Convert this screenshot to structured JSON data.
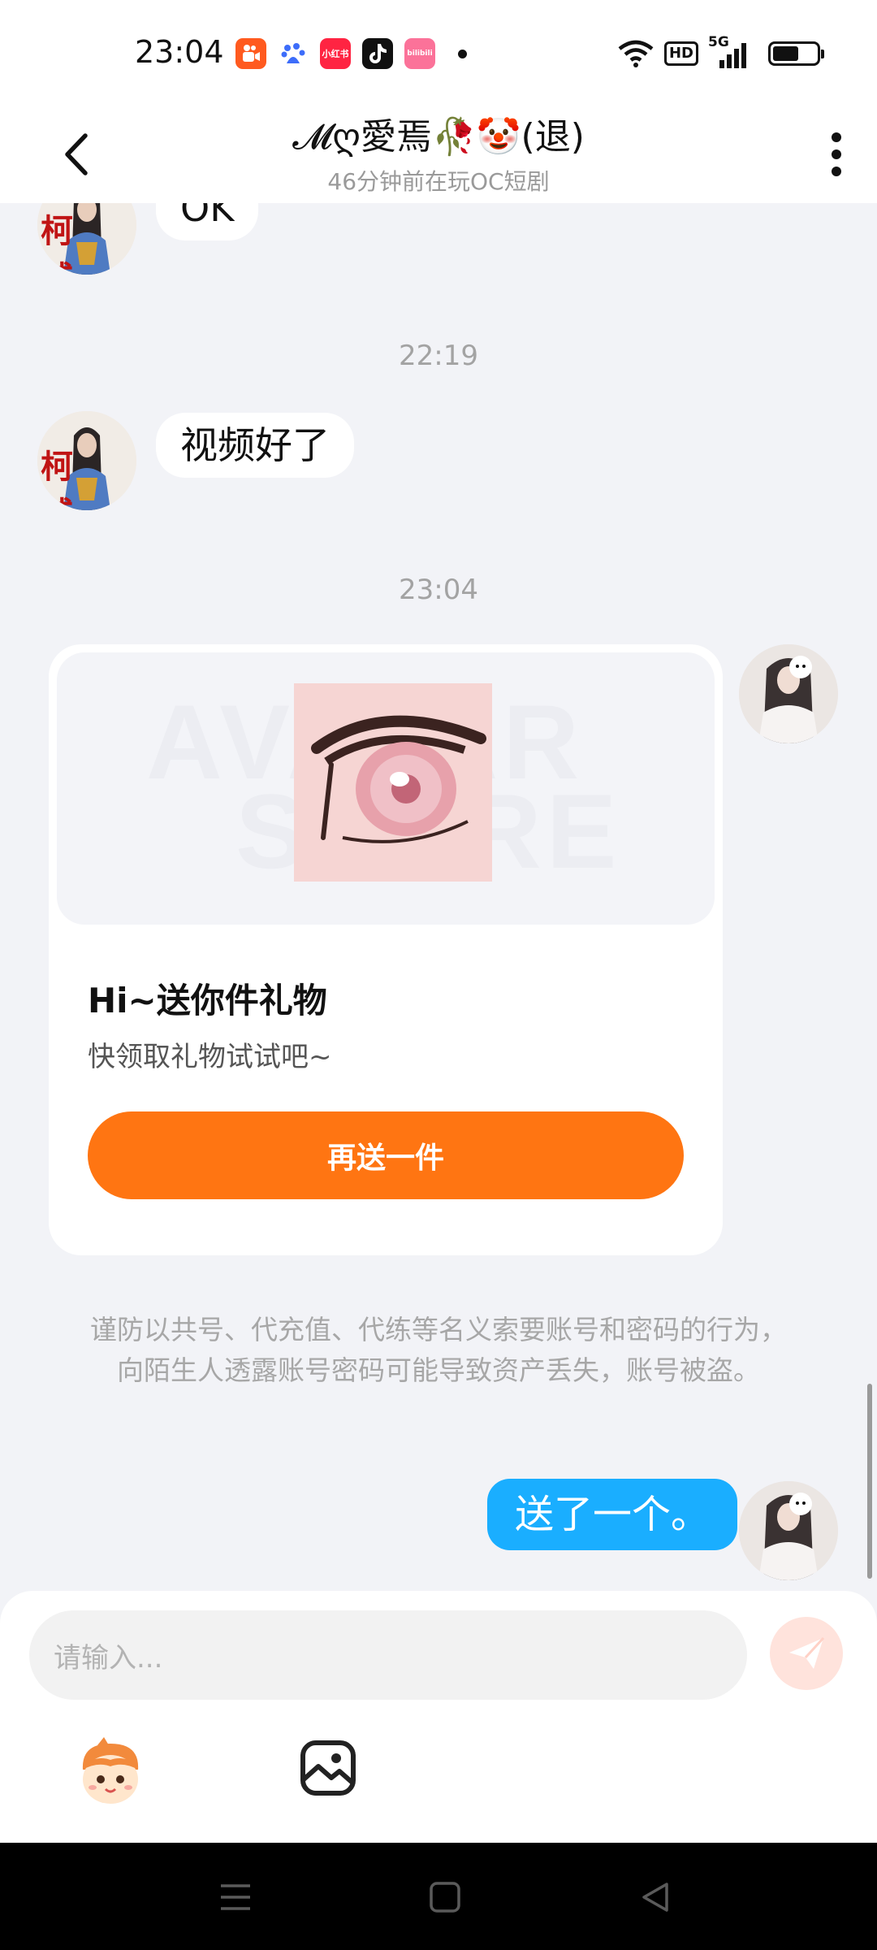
{
  "status_bar": {
    "time": "23:04",
    "apps": [
      {
        "name": "kuaishou-app-icon",
        "color": "#ff5a1f"
      },
      {
        "name": "baidu-app-icon",
        "color": "#3d6dfa"
      },
      {
        "name": "xiaohongshu-app-icon",
        "color": "#ff2442",
        "text": "小红书"
      },
      {
        "name": "douyin-app-icon",
        "color": "#111111"
      },
      {
        "name": "bilibili-app-icon",
        "color": "#fb7299",
        "text": "bilibili"
      }
    ],
    "hd_label": "HD",
    "network_label": "5G",
    "battery_level": 0.6
  },
  "header": {
    "title": "𝓜ღ愛焉🥀🤡(退)",
    "subtitle": "46分钟前在玩OC短剧"
  },
  "messages": [
    {
      "type": "left",
      "text": "OK"
    },
    {
      "type": "time",
      "text": "22:19"
    },
    {
      "type": "left",
      "text": "视频好了"
    },
    {
      "type": "time",
      "text": "23:04"
    }
  ],
  "avatar_text": "柯威",
  "gift_card": {
    "watermark_line1": "AVATAR",
    "watermark_line2": "STORE",
    "title": "Hi~送你件礼物",
    "subtitle": "快领取礼物试试吧~",
    "button_label": "再送一件"
  },
  "notice": "谨防以共号、代充值、代练等名义索要账号和密码的行为，向陌生人透露账号密码可能导致资产丢失，账号被盗。",
  "outgoing_message": "送了一个。",
  "input": {
    "placeholder": "请输入..."
  },
  "colors": {
    "accent_orange": "#ff7512",
    "bubble_blue": "#1aaeff",
    "background": "#f2f3f7"
  }
}
